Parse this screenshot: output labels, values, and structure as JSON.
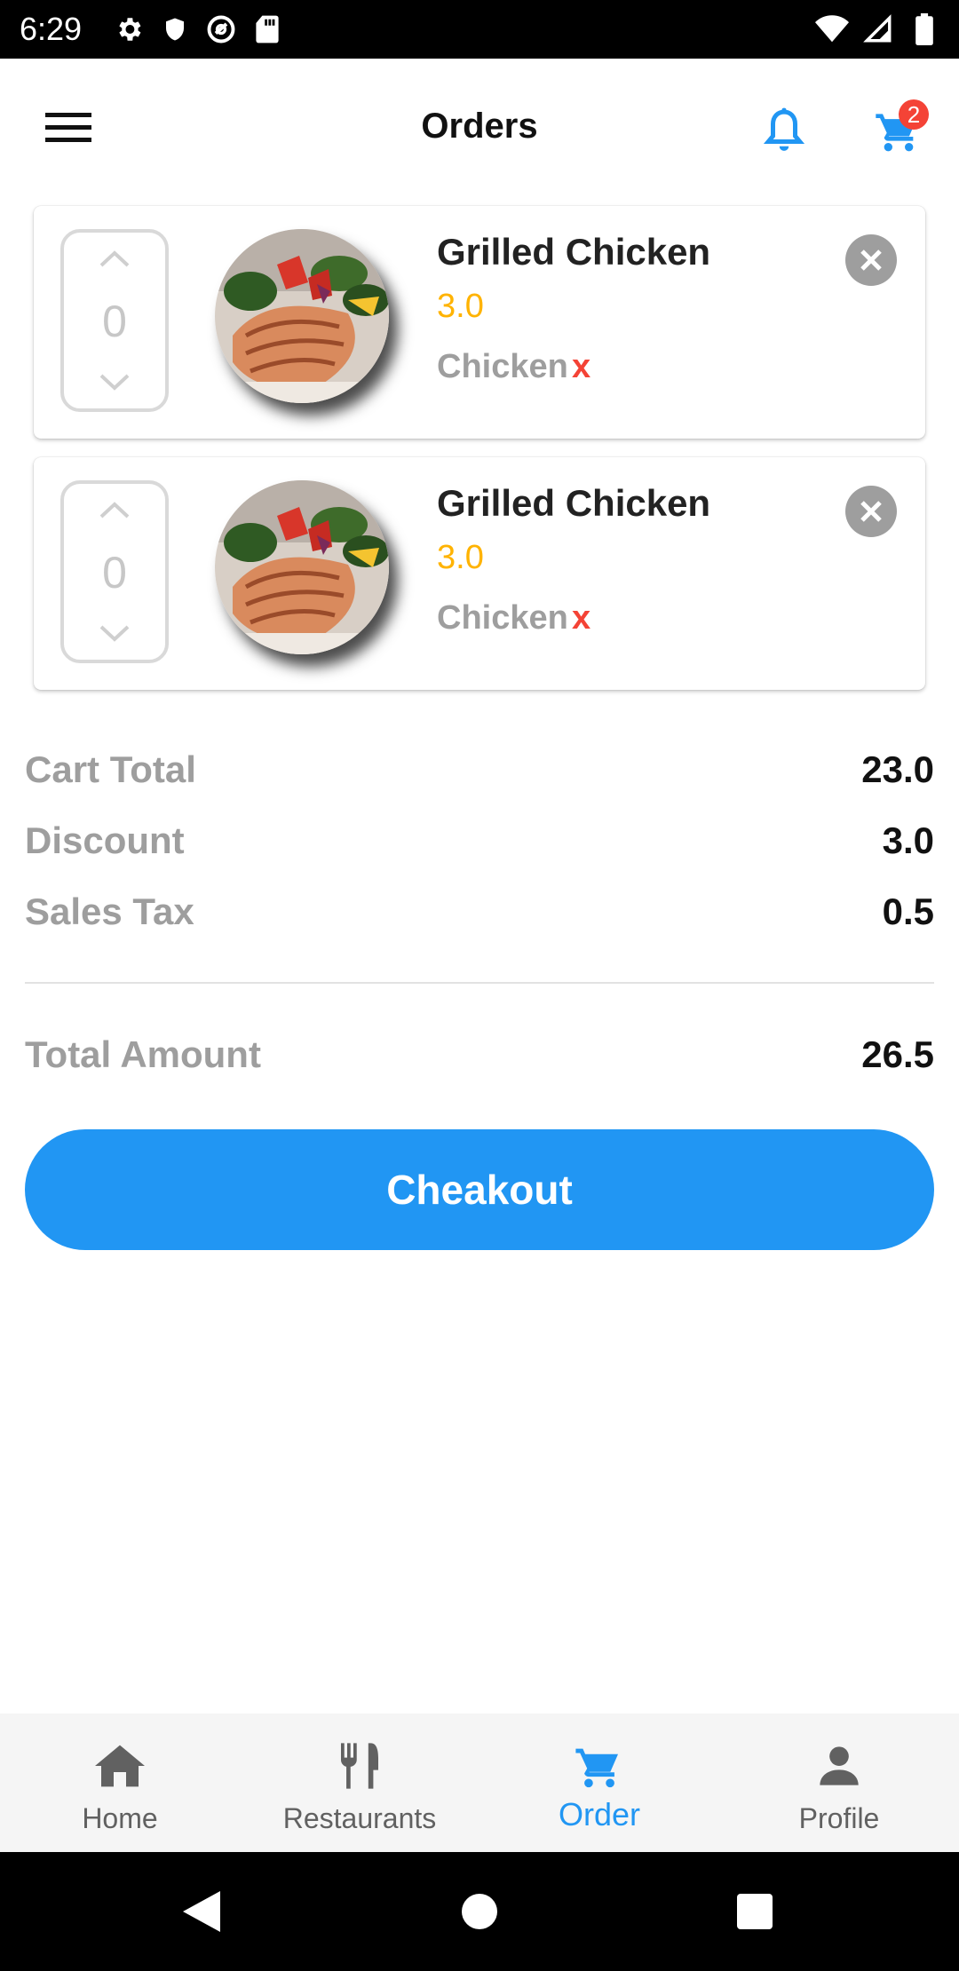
{
  "status_bar": {
    "time": "6:29"
  },
  "header": {
    "title": "Orders",
    "cart_badge": "2"
  },
  "orders": [
    {
      "quantity": "0",
      "name": "Grilled Chicken",
      "price": "3.0",
      "category": "Chicken",
      "category_remove": "x"
    },
    {
      "quantity": "0",
      "name": "Grilled Chicken",
      "price": "3.0",
      "category": "Chicken",
      "category_remove": "x"
    }
  ],
  "summary": {
    "cart_total_label": "Cart Total",
    "cart_total_value": "23.0",
    "discount_label": "Discount",
    "discount_value": "3.0",
    "sales_tax_label": "Sales Tax",
    "sales_tax_value": "0.5",
    "total_label": "Total Amount",
    "total_value": "26.5"
  },
  "checkout_label": "Cheakout",
  "bottom_nav": [
    {
      "label": "Home",
      "icon": "home-icon",
      "active": false
    },
    {
      "label": "Restaurants",
      "icon": "fork-knife-icon",
      "active": false
    },
    {
      "label": "Order",
      "icon": "cart-icon",
      "active": true
    },
    {
      "label": "Profile",
      "icon": "person-icon",
      "active": false
    }
  ],
  "colors": {
    "accent": "#2196f3",
    "price": "#ffb300",
    "remove": "#f44336",
    "muted_text": "#9e9e9e"
  }
}
